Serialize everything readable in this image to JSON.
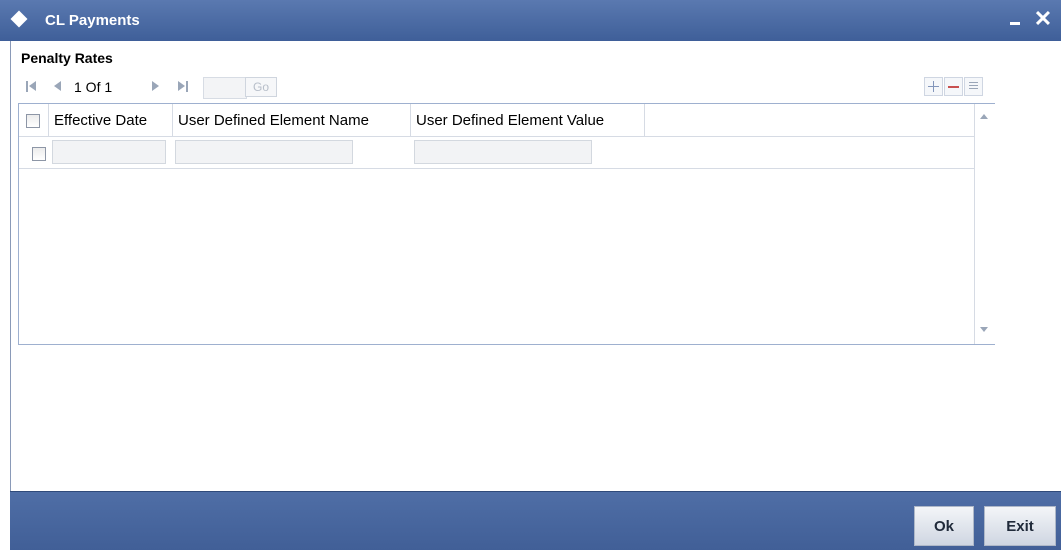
{
  "window": {
    "title": "CL Payments",
    "minimize_icon": "minimize-icon",
    "close_icon": "close-icon"
  },
  "section": {
    "title": "Penalty Rates"
  },
  "navigation": {
    "page_display": "1 Of 1",
    "go_label": "Go",
    "page_input_value": ""
  },
  "toolbar": {
    "add_icon": "plus-icon",
    "delete_icon": "minus-icon",
    "single_view_icon": "list-icon"
  },
  "grid": {
    "columns": [
      "Effective Date",
      "User Defined Element Name",
      "User Defined Element Value"
    ],
    "rows": [
      {
        "effective_date": "",
        "element_name": "",
        "element_value": ""
      }
    ]
  },
  "footer": {
    "ok_label": "Ok",
    "exit_label": "Exit"
  },
  "colors": {
    "titlebar": "#4a6aa3",
    "footer": "#4a69a2",
    "grid_border": "#9eb0cf"
  }
}
